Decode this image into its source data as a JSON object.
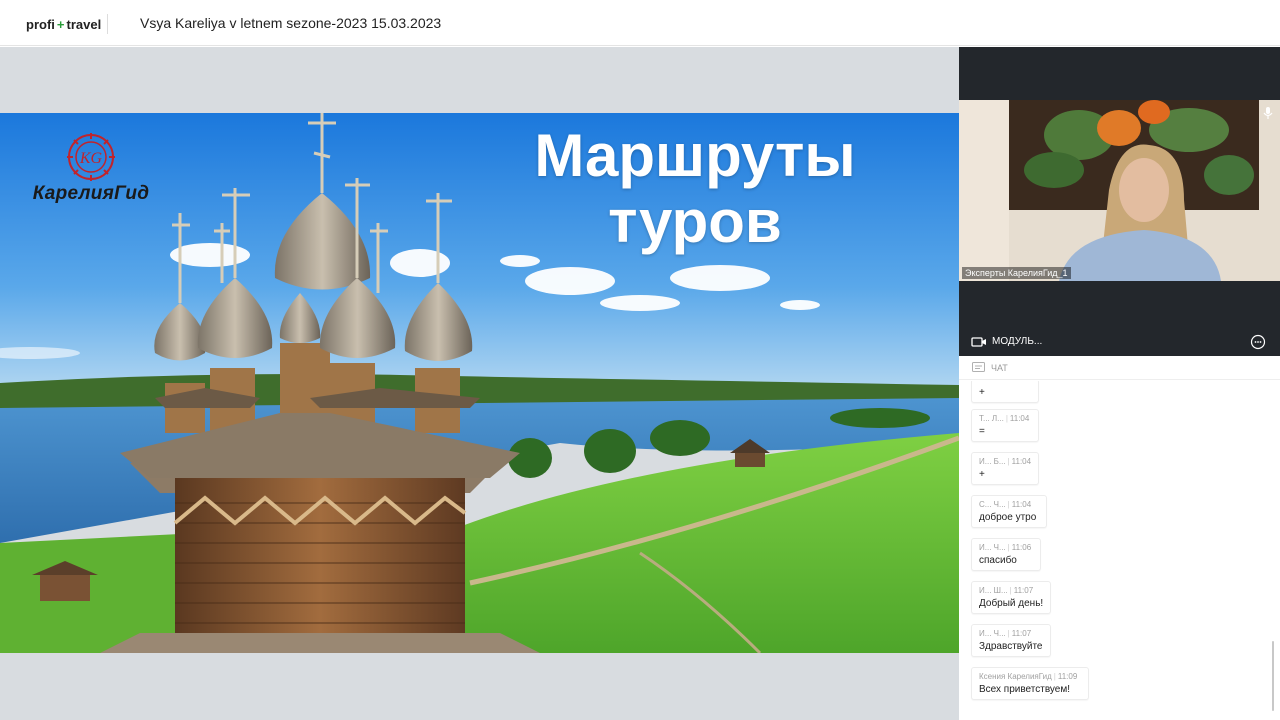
{
  "header": {
    "logo_left": "profi",
    "logo_plus": "+",
    "logo_right": "travel",
    "event_title": "Vsya Kareliya v letnem sezone-2023 15.03.2023"
  },
  "slide": {
    "brand": "КарелияГид",
    "title_line1": "Маршруты",
    "title_line2": "туров"
  },
  "video": {
    "participant_label": "Эксперты КарелияГид_1",
    "module_label": "МОДУЛЬ..."
  },
  "chat": {
    "header_label": "ЧАТ",
    "messages": [
      {
        "author": "",
        "time": "",
        "text": "+"
      },
      {
        "author": "Т... Л...",
        "time": "11:04",
        "text": "="
      },
      {
        "author": "И... Б...",
        "time": "11:04",
        "text": "+"
      },
      {
        "author": "С... Ч...",
        "time": "11:04",
        "text": "доброе утро"
      },
      {
        "author": "И... Ч...",
        "time": "11:06",
        "text": "спасибо"
      },
      {
        "author": "И... Ш...",
        "time": "11:07",
        "text": "Добрый день!"
      },
      {
        "author": "И... Ч...",
        "time": "11:07",
        "text": "Здравствуйте"
      },
      {
        "author": "Ксения КарелияГид",
        "time": "11:09",
        "text": "Всех приветствуем!"
      }
    ]
  },
  "colors": {
    "sky_top": "#1f7fe0",
    "lake": "#3d86c9",
    "grass": "#6cc23a",
    "wood": "#8a5a34",
    "dark_panel": "#23272c"
  }
}
